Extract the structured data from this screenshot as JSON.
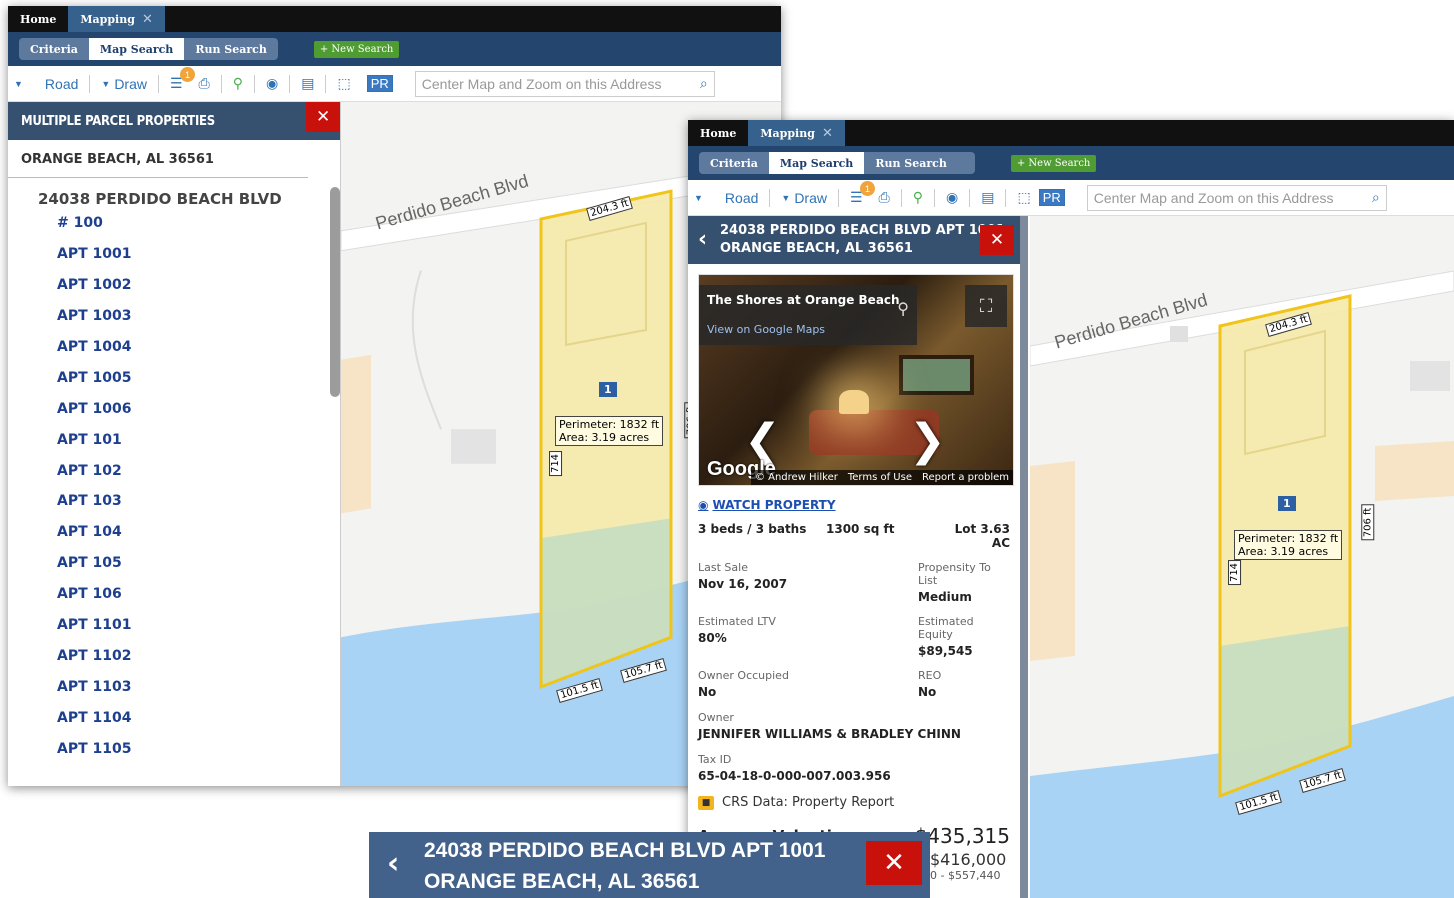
{
  "tabs": [
    "Home",
    "Mapping"
  ],
  "search_modes": [
    "Criteria",
    "Map Search",
    "Run Search"
  ],
  "new_search": "+ New Search",
  "toolbar": {
    "road": "Road",
    "draw": "Draw",
    "layers_badge": "1",
    "pr": "PR",
    "address_placeholder": "Center Map and Zoom on this Address"
  },
  "left_panel": {
    "title": "MULTIPLE PARCEL PROPERTIES",
    "city": "ORANGE BEACH, AL 36561",
    "street": "24038 PERDIDO BEACH BLVD",
    "units": [
      "# 100",
      "APT 1001",
      "APT 1002",
      "APT 1003",
      "APT 1004",
      "APT 1005",
      "APT 1006",
      "APT 101",
      "APT 102",
      "APT 103",
      "APT 104",
      "APT 105",
      "APT 106",
      "APT 1101",
      "APT 1102",
      "APT 1103",
      "APT 1104",
      "APT 1105"
    ]
  },
  "map": {
    "road_name": "Perdido Beach Blvd",
    "dims": [
      "204.3 ft",
      "706 ft",
      "714",
      "101.5 ft",
      "105.7 ft"
    ],
    "marker": "1",
    "perimeter": "Perimeter: 1832 ft",
    "area": "Area: 3.19 acres"
  },
  "detail": {
    "line1": "24038 PERDIDO BEACH BLVD APT 1001",
    "line2": "ORANGE BEACH, AL 36561",
    "photo_title": "The Shores at Orange Beach",
    "photo_link": "View on Google Maps",
    "google": "Google",
    "attribution": [
      "© Andrew Hilker",
      "Terms of Use",
      "Report a problem"
    ],
    "watch": "WATCH PROPERTY",
    "beds": "3 beds / 3 baths",
    "sqft": "1300 sq ft",
    "lot": "Lot  3.63 AC",
    "rows": [
      {
        "lk": "Last Sale",
        "lv": "Nov 16, 2007",
        "rk": "Propensity To List",
        "rv": "Medium"
      },
      {
        "lk": "Estimated LTV",
        "lv": "80%",
        "rk": "Estimated Equity",
        "rv": "$89,545"
      },
      {
        "lk": "Owner Occupied",
        "lv": "No",
        "rk": "REO",
        "rv": "No"
      }
    ],
    "owner_k": "Owner",
    "owner_v": "JENNIFER WILLIAMS & BRADLEY CHINN",
    "tax_k": "Tax ID",
    "tax_v": "65-04-18-0-000-007.003.956",
    "crs": "CRS Data: Property Report",
    "avg_k": "Average Valuation",
    "avg_v": "$435,315",
    "peek_v": "$416,000",
    "peek_range": "0 - $557,440"
  },
  "colors": {
    "header": "#36506f",
    "close": "#c8110b",
    "water": "#a9d3f5",
    "parcel": "#f5e9a8",
    "parcel_border": "#f0c419"
  }
}
